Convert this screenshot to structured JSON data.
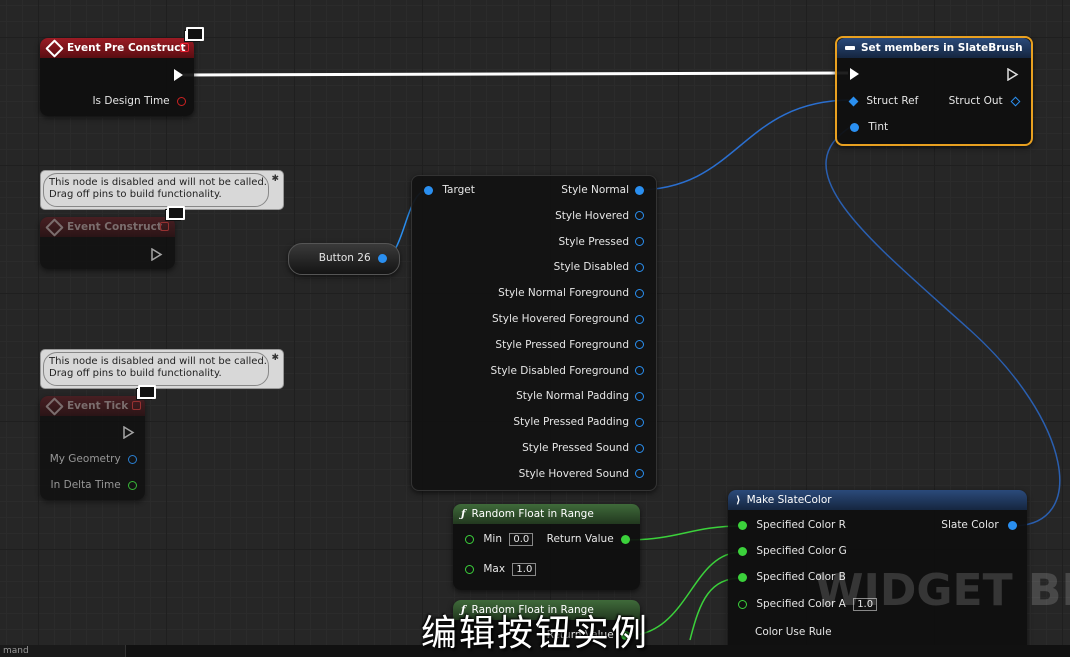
{
  "nodes": {
    "event_pre_construct": {
      "title": "Event Pre Construct",
      "pin_is_design_time": "Is Design Time"
    },
    "event_construct": {
      "title": "Event Construct"
    },
    "event_tick": {
      "title": "Event Tick",
      "pin_my_geometry": "My Geometry",
      "pin_in_delta_time": "In Delta Time"
    },
    "comment": {
      "line1": "This node is disabled and will not be called.",
      "line2": "Drag off pins to build functionality."
    },
    "button_var": {
      "label": "Button 26"
    },
    "style_break": {
      "target": "Target",
      "outputs": [
        "Style Normal",
        "Style Hovered",
        "Style Pressed",
        "Style Disabled",
        "Style Normal Foreground",
        "Style Hovered Foreground",
        "Style Pressed Foreground",
        "Style Disabled Foreground",
        "Style Normal Padding",
        "Style Pressed Padding",
        "Style Pressed Sound",
        "Style Hovered Sound"
      ]
    },
    "set_members": {
      "title": "Set members in SlateBrush",
      "struct_ref": "Struct Ref",
      "struct_out": "Struct Out",
      "tint": "Tint"
    },
    "random_float": {
      "title": "Random Float in Range",
      "min_label": "Min",
      "min_value": "0.0",
      "max_label": "Max",
      "max_value": "1.0",
      "return_value": "Return Value"
    },
    "random_float_2": {
      "title": "Random Float in Range",
      "return_value": "Return Value"
    },
    "make_slate_color": {
      "title": "Make SlateColor",
      "color_r": "Specified Color R",
      "color_g": "Specified Color G",
      "color_b": "Specified Color B",
      "color_a": "Specified Color A",
      "color_a_value": "1.0",
      "color_use_rule": "Color Use Rule",
      "slate_color": "Slate Color"
    }
  },
  "overlay": {
    "subtitle": "编辑按钮实例",
    "watermark": "WIDGET BLU",
    "command_label": "mand"
  },
  "colors": {
    "exec": "#ffffff",
    "struct_pin": "#2a8ff0",
    "float_pin": "#3bd13b",
    "event_header": "#9b1b24",
    "selected_border": "#e8a020"
  },
  "icons": [
    "diamond-event-icon",
    "monitor-icon",
    "function-icon",
    "struct-icon",
    "exec-pin-icon"
  ]
}
